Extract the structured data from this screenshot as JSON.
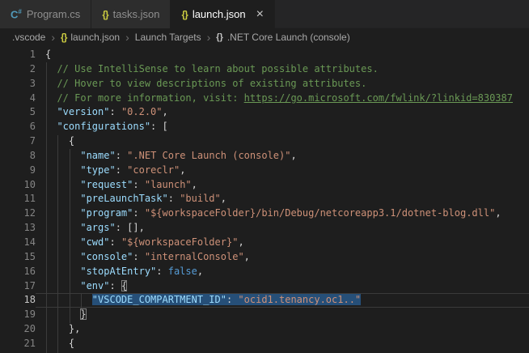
{
  "icons": {
    "json": "{}",
    "object": "{}",
    "csharp_main": "C",
    "csharp_sup": "#",
    "close": "×",
    "breadcrumb_separator": "›"
  },
  "colors": {
    "editor_bg": "#1e1e1e",
    "tabstrip_bg": "#252526",
    "inactive_tab_bg": "#2d2d2d",
    "active_tab_bg": "#1e1e1e",
    "key": "#9cdcfe",
    "string": "#ce9178",
    "comment": "#6a9955",
    "boolean": "#569cd6",
    "punctuation": "#d4d4d4",
    "selection_bg": "#264f78",
    "json_icon": "#cbcb41",
    "csharp_icon": "#519aba"
  },
  "tabs": [
    {
      "label": "Program.cs",
      "icon": "csharp",
      "active": false
    },
    {
      "label": "tasks.json",
      "icon": "json",
      "active": false
    },
    {
      "label": "launch.json",
      "icon": "json",
      "active": true,
      "close": true
    }
  ],
  "breadcrumb": {
    "items": [
      {
        "label": ".vscode"
      },
      {
        "label": "launch.json",
        "icon": "json"
      },
      {
        "label": "Launch Targets"
      },
      {
        "label": ".NET Core Launch (console)",
        "icon": "object"
      }
    ]
  },
  "editor": {
    "lines": [
      {
        "n": 1,
        "toks": [
          {
            "t": "{",
            "c": "p"
          }
        ]
      },
      {
        "n": 2,
        "toks": [
          {
            "t": "  // Use IntelliSense to learn about possible attributes.",
            "c": "c"
          }
        ]
      },
      {
        "n": 3,
        "toks": [
          {
            "t": "  // Hover to view descriptions of existing attributes.",
            "c": "c"
          }
        ]
      },
      {
        "n": 4,
        "toks": [
          {
            "t": "  // For more information, visit: ",
            "c": "c"
          },
          {
            "t": "https://go.microsoft.com/fwlink/?linkid=830387",
            "c": "l"
          }
        ]
      },
      {
        "n": 5,
        "toks": [
          {
            "t": "  ",
            "c": "p"
          },
          {
            "t": "\"version\"",
            "c": "k"
          },
          {
            "t": ": ",
            "c": "p"
          },
          {
            "t": "\"0.2.0\"",
            "c": "s"
          },
          {
            "t": ",",
            "c": "p"
          }
        ]
      },
      {
        "n": 6,
        "toks": [
          {
            "t": "  ",
            "c": "p"
          },
          {
            "t": "\"configurations\"",
            "c": "k"
          },
          {
            "t": ": [",
            "c": "p"
          }
        ]
      },
      {
        "n": 7,
        "toks": [
          {
            "t": "    {",
            "c": "p"
          }
        ]
      },
      {
        "n": 8,
        "toks": [
          {
            "t": "      ",
            "c": "p"
          },
          {
            "t": "\"name\"",
            "c": "k"
          },
          {
            "t": ": ",
            "c": "p"
          },
          {
            "t": "\".NET Core Launch (console)\"",
            "c": "s"
          },
          {
            "t": ",",
            "c": "p"
          }
        ]
      },
      {
        "n": 9,
        "toks": [
          {
            "t": "      ",
            "c": "p"
          },
          {
            "t": "\"type\"",
            "c": "k"
          },
          {
            "t": ": ",
            "c": "p"
          },
          {
            "t": "\"coreclr\"",
            "c": "s"
          },
          {
            "t": ",",
            "c": "p"
          }
        ]
      },
      {
        "n": 10,
        "toks": [
          {
            "t": "      ",
            "c": "p"
          },
          {
            "t": "\"request\"",
            "c": "k"
          },
          {
            "t": ": ",
            "c": "p"
          },
          {
            "t": "\"launch\"",
            "c": "s"
          },
          {
            "t": ",",
            "c": "p"
          }
        ]
      },
      {
        "n": 11,
        "toks": [
          {
            "t": "      ",
            "c": "p"
          },
          {
            "t": "\"preLaunchTask\"",
            "c": "k"
          },
          {
            "t": ": ",
            "c": "p"
          },
          {
            "t": "\"build\"",
            "c": "s"
          },
          {
            "t": ",",
            "c": "p"
          }
        ]
      },
      {
        "n": 12,
        "toks": [
          {
            "t": "      ",
            "c": "p"
          },
          {
            "t": "\"program\"",
            "c": "k"
          },
          {
            "t": ": ",
            "c": "p"
          },
          {
            "t": "\"${workspaceFolder}/bin/Debug/netcoreapp3.1/dotnet-blog.dll\"",
            "c": "s"
          },
          {
            "t": ",",
            "c": "p"
          }
        ]
      },
      {
        "n": 13,
        "toks": [
          {
            "t": "      ",
            "c": "p"
          },
          {
            "t": "\"args\"",
            "c": "k"
          },
          {
            "t": ": [],",
            "c": "p"
          }
        ]
      },
      {
        "n": 14,
        "toks": [
          {
            "t": "      ",
            "c": "p"
          },
          {
            "t": "\"cwd\"",
            "c": "k"
          },
          {
            "t": ": ",
            "c": "p"
          },
          {
            "t": "\"${workspaceFolder}\"",
            "c": "s"
          },
          {
            "t": ",",
            "c": "p"
          }
        ]
      },
      {
        "n": 15,
        "toks": [
          {
            "t": "      ",
            "c": "p"
          },
          {
            "t": "\"console\"",
            "c": "k"
          },
          {
            "t": ": ",
            "c": "p"
          },
          {
            "t": "\"internalConsole\"",
            "c": "s"
          },
          {
            "t": ",",
            "c": "p"
          }
        ]
      },
      {
        "n": 16,
        "toks": [
          {
            "t": "      ",
            "c": "p"
          },
          {
            "t": "\"stopAtEntry\"",
            "c": "k"
          },
          {
            "t": ": ",
            "c": "p"
          },
          {
            "t": "false",
            "c": "b"
          },
          {
            "t": ",",
            "c": "p"
          }
        ]
      },
      {
        "n": 17,
        "toks": [
          {
            "t": "      ",
            "c": "p"
          },
          {
            "t": "\"env\"",
            "c": "k"
          },
          {
            "t": ": ",
            "c": "p"
          },
          {
            "t": "{",
            "c": "p",
            "bm": true
          }
        ]
      },
      {
        "n": 18,
        "cur": true,
        "toks": [
          {
            "t": "        ",
            "c": "p"
          },
          {
            "t": "\"VSCODE_COMPARTMENT_ID\"",
            "c": "k",
            "sel": true
          },
          {
            "t": ": ",
            "c": "p",
            "sel": true
          },
          {
            "t": "\"ocid1.tenancy.oc1..\"",
            "c": "s",
            "sel": true
          }
        ]
      },
      {
        "n": 19,
        "toks": [
          {
            "t": "      ",
            "c": "p"
          },
          {
            "t": "}",
            "c": "p",
            "bm": true
          }
        ]
      },
      {
        "n": 20,
        "toks": [
          {
            "t": "    },",
            "c": "p"
          }
        ]
      },
      {
        "n": 21,
        "toks": [
          {
            "t": "    {",
            "c": "p"
          }
        ]
      }
    ]
  }
}
